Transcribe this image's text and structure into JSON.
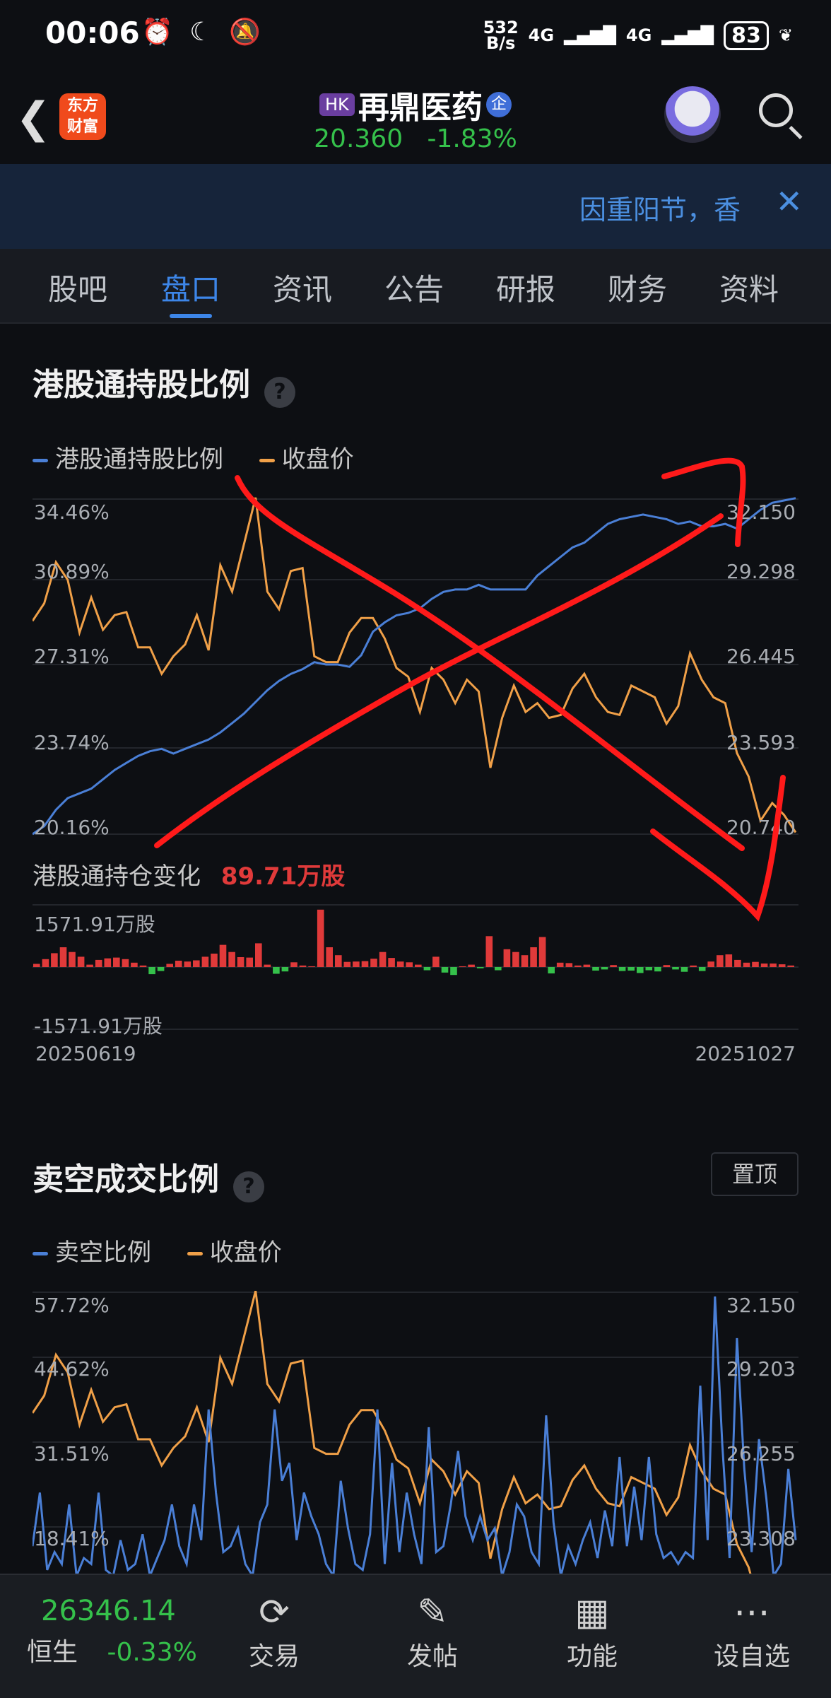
{
  "status_bar": {
    "time": "00:06",
    "speed_top": "532",
    "speed_bottom": "B/s",
    "net1": "4G",
    "net2": "4G",
    "battery": "83"
  },
  "header": {
    "logo_line1": "东方",
    "logo_line2": "财富",
    "market_badge": "HK",
    "stock_name": "再鼎医药",
    "corp_badge": "企",
    "price": "20.360",
    "change": "-1.83%"
  },
  "banner": {
    "text": "因重阳节，香"
  },
  "tabs": [
    "股吧",
    "盘口",
    "资讯",
    "公告",
    "研报",
    "财务",
    "资料"
  ],
  "section1": {
    "title": "港股通持股比例",
    "legend_a": "港股通持股比例",
    "legend_b": "收盘价",
    "left_ticks": [
      "34.46%",
      "30.89%",
      "27.31%",
      "23.74%",
      "20.16%"
    ],
    "right_ticks": [
      "32.150",
      "29.298",
      "26.445",
      "23.593",
      "20.740"
    ],
    "sub_label": "港股通持仓变化",
    "sub_value": "89.71万股",
    "bar_max": "1571.91万股",
    "bar_min": "-1571.91万股",
    "date_start": "20250619",
    "date_end": "20251027"
  },
  "section2": {
    "title": "卖空成交比例",
    "pin": "置顶",
    "legend_a": "卖空比例",
    "legend_b": "收盘价",
    "left_ticks": [
      "57.72%",
      "44.62%",
      "31.51%",
      "18.41%"
    ],
    "right_ticks": [
      "32.150",
      "29.203",
      "26.255",
      "23.308"
    ]
  },
  "bottom_nav": {
    "index_value": "26346.14",
    "index_name": "恒生",
    "index_change": "-0.33%",
    "items": [
      "交易",
      "发帖",
      "功能",
      "设自选"
    ]
  },
  "colors": {
    "up": "#e03a3a",
    "down": "#35c14b",
    "accent": "#3d86e8",
    "ratio_line": "#4a7fd6",
    "price_line": "#f0a048",
    "annotation": "#ff1a1a"
  },
  "chart_data": [
    {
      "type": "line",
      "title": "港股通持股比例",
      "x_range": [
        "20250619",
        "20251027"
      ],
      "series": [
        {
          "name": "港股通持股比例",
          "axis": "left",
          "ylim": [
            20.16,
            34.46
          ],
          "values": [
            20.16,
            20.5,
            21.2,
            21.7,
            21.9,
            22.1,
            22.5,
            22.9,
            23.2,
            23.5,
            23.7,
            23.8,
            23.6,
            23.8,
            24.0,
            24.2,
            24.5,
            24.9,
            25.3,
            25.8,
            26.3,
            26.7,
            27.0,
            27.2,
            27.5,
            27.4,
            27.4,
            27.3,
            27.8,
            28.8,
            29.2,
            29.5,
            29.6,
            29.8,
            30.2,
            30.5,
            30.6,
            30.6,
            30.8,
            30.6,
            30.6,
            30.6,
            30.6,
            31.2,
            31.6,
            32.0,
            32.4,
            32.6,
            33.0,
            33.4,
            33.6,
            33.7,
            33.8,
            33.7,
            33.6,
            33.4,
            33.5,
            33.3,
            33.3,
            33.4,
            33.2,
            33.6,
            34.0,
            34.3,
            34.4,
            34.5
          ]
        },
        {
          "name": "收盘价",
          "axis": "right",
          "ylim": [
            20.74,
            32.15
          ],
          "values": [
            28.0,
            28.6,
            30.0,
            29.4,
            27.6,
            28.8,
            27.7,
            28.2,
            28.3,
            27.1,
            27.1,
            26.2,
            26.8,
            27.2,
            28.2,
            27.0,
            29.9,
            29.0,
            30.6,
            32.2,
            29.0,
            28.4,
            29.7,
            29.8,
            26.8,
            26.6,
            26.6,
            27.6,
            28.1,
            28.1,
            27.4,
            26.4,
            26.1,
            24.9,
            26.4,
            26.0,
            25.2,
            26.0,
            25.6,
            23.0,
            24.7,
            25.8,
            24.9,
            25.2,
            24.7,
            24.8,
            25.7,
            26.2,
            25.4,
            24.9,
            24.8,
            25.8,
            25.6,
            25.4,
            24.5,
            25.1,
            26.9,
            26.0,
            25.4,
            25.2,
            23.5,
            22.7,
            21.2,
            21.8,
            21.4,
            20.8
          ]
        }
      ],
      "left_ticks": [
        "34.46%",
        "30.89%",
        "27.31%",
        "23.74%",
        "20.16%"
      ],
      "right_ticks": [
        "32.150",
        "29.298",
        "26.445",
        "23.593",
        "20.740"
      ]
    },
    {
      "type": "bar",
      "title": "港股通持仓变化",
      "unit": "万股",
      "ylim": [
        -1571.91,
        1571.91
      ],
      "values": [
        80,
        200,
        350,
        500,
        380,
        260,
        60,
        180,
        220,
        240,
        200,
        110,
        40,
        -180,
        -100,
        80,
        160,
        140,
        170,
        260,
        340,
        560,
        380,
        250,
        240,
        600,
        60,
        -170,
        -110,
        120,
        40,
        20,
        1450,
        500,
        300,
        130,
        140,
        150,
        210,
        380,
        230,
        140,
        120,
        60,
        -80,
        260,
        -140,
        -200,
        20,
        60,
        -30,
        780,
        -80,
        450,
        380,
        300,
        500,
        760,
        -160,
        110,
        100,
        40,
        60,
        -90,
        -60,
        50,
        -100,
        -90,
        -150,
        -80,
        -110,
        50,
        -60,
        -120,
        40,
        -100,
        140,
        300,
        320,
        180,
        110,
        130,
        90,
        90,
        70,
        40
      ]
    },
    {
      "type": "line",
      "title": "卖空成交比例",
      "series": [
        {
          "name": "卖空比例",
          "axis": "left",
          "ylim": [
            8,
            57.72
          ],
          "values": [
            15,
            24,
            11,
            14,
            12,
            22,
            10,
            13,
            12,
            24,
            11,
            10,
            16,
            11,
            12,
            17,
            10,
            13,
            16,
            22,
            15,
            12,
            22,
            16,
            38,
            24,
            14,
            15,
            18,
            12,
            10,
            19,
            22,
            38,
            26,
            29,
            16,
            24,
            20,
            17,
            12,
            10,
            26,
            18,
            12,
            11,
            17,
            38,
            12,
            29,
            14,
            24,
            17,
            12,
            35,
            14,
            15,
            22,
            31,
            20,
            16,
            20,
            16,
            18,
            10,
            14,
            22,
            20,
            14,
            12,
            37,
            19,
            10,
            15,
            12,
            16,
            19,
            13,
            21,
            15,
            30,
            15,
            25,
            16,
            30,
            17,
            13,
            14,
            12,
            14,
            13,
            42,
            16,
            57,
            32,
            13,
            50,
            28,
            14,
            33,
            23,
            10,
            12,
            28,
            16
          ]
        },
        {
          "name": "收盘价",
          "axis": "right",
          "ylim": [
            22.0,
            32.15
          ],
          "values": [
            28.0,
            28.6,
            30.0,
            29.4,
            27.6,
            28.8,
            27.7,
            28.2,
            28.3,
            27.1,
            27.1,
            26.2,
            26.8,
            27.2,
            28.2,
            27.0,
            29.9,
            29.0,
            30.6,
            32.2,
            29.0,
            28.4,
            29.7,
            29.8,
            26.8,
            26.6,
            26.6,
            27.6,
            28.1,
            28.1,
            27.4,
            26.4,
            26.1,
            24.9,
            26.4,
            26.0,
            25.2,
            26.0,
            25.6,
            23.0,
            24.7,
            25.8,
            24.9,
            25.2,
            24.7,
            24.8,
            25.7,
            26.2,
            25.4,
            24.9,
            24.8,
            25.8,
            25.6,
            25.4,
            24.5,
            25.1,
            26.9,
            26.0,
            25.4,
            25.2,
            23.5,
            22.7,
            21.2,
            21.8,
            21.4,
            20.8
          ]
        }
      ],
      "left_ticks": [
        "57.72%",
        "44.62%",
        "31.51%",
        "18.41%"
      ],
      "right_ticks": [
        "32.150",
        "29.203",
        "26.255",
        "23.308"
      ]
    }
  ]
}
